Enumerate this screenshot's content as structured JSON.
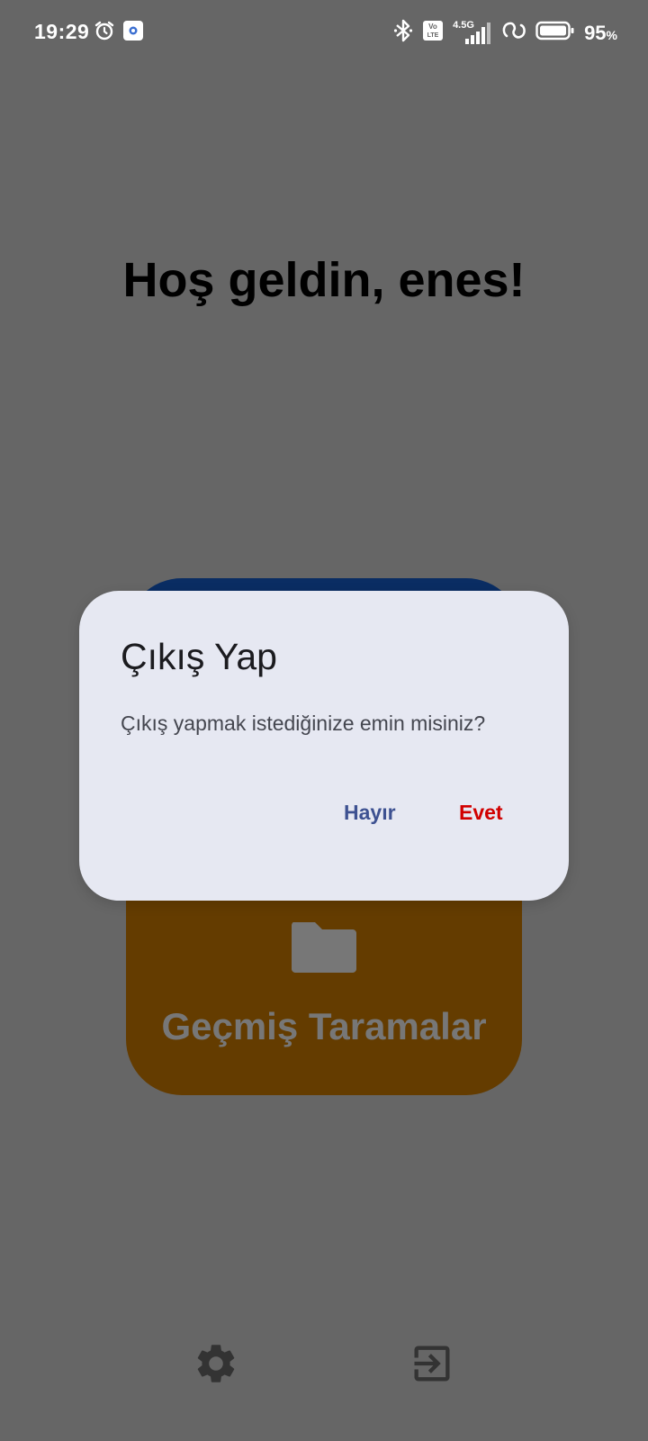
{
  "status_bar": {
    "time": "19:29",
    "battery_percent": "95",
    "battery_suffix": "%",
    "network_type": "4.5G",
    "volte_label": "Vo LTE",
    "icons": [
      "alarm-icon",
      "app-notification-icon",
      "bluetooth-icon",
      "volte-icon",
      "signal-icon",
      "hotspot-icon",
      "battery-icon"
    ]
  },
  "greeting": "Hoş geldin, enes!",
  "cards": {
    "history": {
      "label": "Geçmiş Taramalar",
      "icon": "folder-icon"
    }
  },
  "bottom_nav": {
    "icons": [
      "gear-icon",
      "logout-icon"
    ]
  },
  "dialog": {
    "title": "Çıkış Yap",
    "message": "Çıkış yapmak istediğinize emin misiniz?",
    "negative_label": "Hayır",
    "positive_label": "Evet"
  },
  "colors": {
    "overlay_background": "#666666",
    "dialog_background": "#e6e8f2",
    "scan_card": "#0a2d63",
    "history_card": "#643c00",
    "negative_button": "#3d5191",
    "positive_button": "#d10000"
  }
}
